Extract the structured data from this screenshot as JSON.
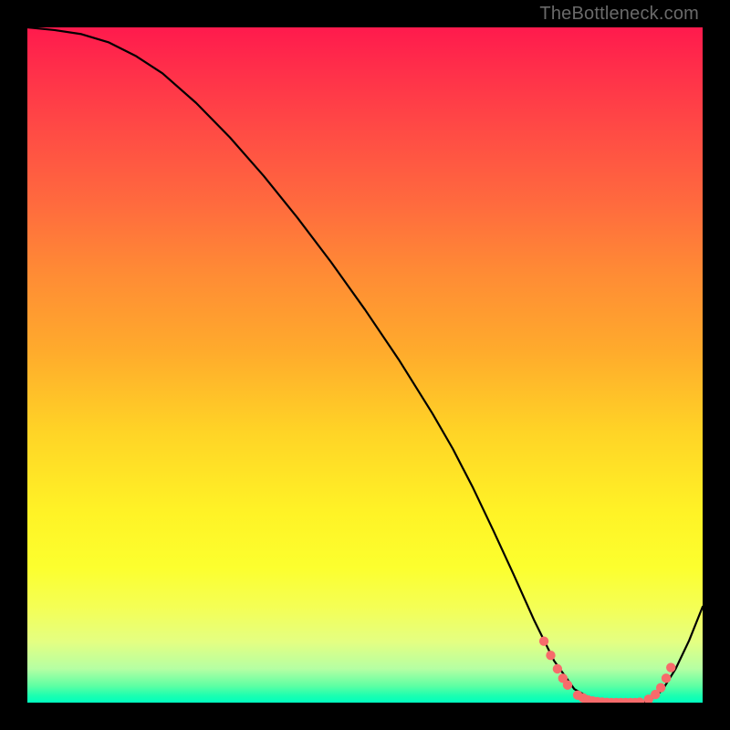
{
  "watermark": "TheBottleneck.com",
  "colors": {
    "background": "#000000",
    "curve": "#000000",
    "marker_fill": "#f76b6b",
    "marker_stroke": "#c94f4f",
    "gradient_top": "#ff1a4d",
    "gradient_bottom": "#00ffc0"
  },
  "chart_data": {
    "type": "line",
    "title": "",
    "xlabel": "",
    "ylabel": "",
    "xlim": [
      0,
      100
    ],
    "ylim": [
      0,
      100
    ],
    "grid": false,
    "legend": false,
    "series": [
      {
        "name": "curve",
        "x": [
          0,
          4,
          8,
          12,
          16,
          20,
          25,
          30,
          35,
          40,
          45,
          50,
          55,
          60,
          63,
          66,
          69,
          72,
          75,
          78,
          81,
          84,
          86,
          88,
          90,
          92,
          94,
          96,
          98,
          100
        ],
        "y": [
          100,
          99.6,
          99.0,
          97.8,
          95.8,
          93.2,
          88.8,
          83.7,
          78.0,
          71.8,
          65.2,
          58.2,
          50.8,
          42.8,
          37.6,
          31.8,
          25.5,
          19.0,
          12.3,
          6.2,
          2.0,
          0.3,
          0.0,
          0.0,
          0.0,
          0.2,
          1.8,
          5.0,
          9.2,
          14.2
        ]
      }
    ],
    "markers": {
      "name": "highlighted-points",
      "x": [
        76.5,
        77.5,
        78.5,
        79.3,
        80.0,
        81.5,
        82.3,
        83.0,
        83.7,
        84.4,
        85.1,
        85.8,
        86.5,
        87.2,
        87.9,
        88.6,
        89.3,
        90.0,
        90.7,
        92.0,
        93.0,
        93.8,
        94.6,
        95.3
      ],
      "y": [
        9.1,
        7.0,
        5.0,
        3.6,
        2.6,
        1.1,
        0.7,
        0.4,
        0.25,
        0.15,
        0.08,
        0.03,
        0.0,
        0.0,
        0.0,
        0.0,
        0.0,
        0.0,
        0.05,
        0.5,
        1.2,
        2.2,
        3.6,
        5.2
      ]
    }
  }
}
